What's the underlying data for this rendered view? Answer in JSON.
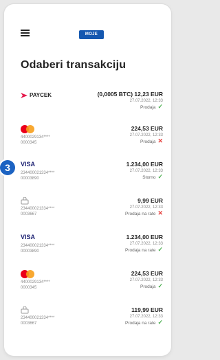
{
  "header": {
    "logo_text": "MOJE"
  },
  "page": {
    "title": "Odaberi transakciju"
  },
  "transactions": [
    {
      "brand": "PAYCEK",
      "brand_sub": "",
      "card_number": "",
      "ref": "",
      "amount": "(0,0005 BTC) 12,23 EUR",
      "date": "27.07.2022, 12:33",
      "status": "Prodaja",
      "status_mark": "✓"
    },
    {
      "brand": "Mastercard",
      "card_number": "4400029134****",
      "ref": "0000345",
      "amount": "224,53 EUR",
      "date": "27.07.2022, 12:33",
      "status": "Prodaja",
      "status_mark": "✕"
    },
    {
      "brand": "VISA",
      "card_number": "234400021334****",
      "ref": "00003890",
      "amount": "1.234,00 EUR",
      "date": "27.07.2022, 12:33",
      "status": "Storno",
      "status_mark": "✓"
    },
    {
      "brand": "Installment",
      "card_number": "234400021334****",
      "ref": "0003667",
      "amount": "9,99 EUR",
      "date": "27.07.2022, 12:33",
      "status": "Prodaja na rate",
      "status_mark": "✕"
    },
    {
      "brand": "VISA",
      "card_number": "234400021334****",
      "ref": "00003890",
      "amount": "1.234,00 EUR",
      "date": "27.07.2022, 12:33",
      "status": "Prodaja na rate",
      "status_mark": "✓"
    },
    {
      "brand": "Mastercard",
      "card_number": "4400029134****",
      "ref": "0000345",
      "amount": "224,53 EUR",
      "date": "27.07.2022, 12:33",
      "status": "Prodaja",
      "status_mark": "✓"
    },
    {
      "brand": "Installment",
      "card_number": "234400021334****",
      "ref": "0003667",
      "amount": "119,99 EUR",
      "date": "27.07.2022, 12:33",
      "status": "Prodaja na rate",
      "status_mark": "✓"
    }
  ],
  "annotation": {
    "badge_number": "3"
  },
  "colors": {
    "accent": "#1558b0",
    "badge": "#1c63c2",
    "success": "#4caf50",
    "error": "#e53935",
    "paycek": "#e5194c"
  }
}
